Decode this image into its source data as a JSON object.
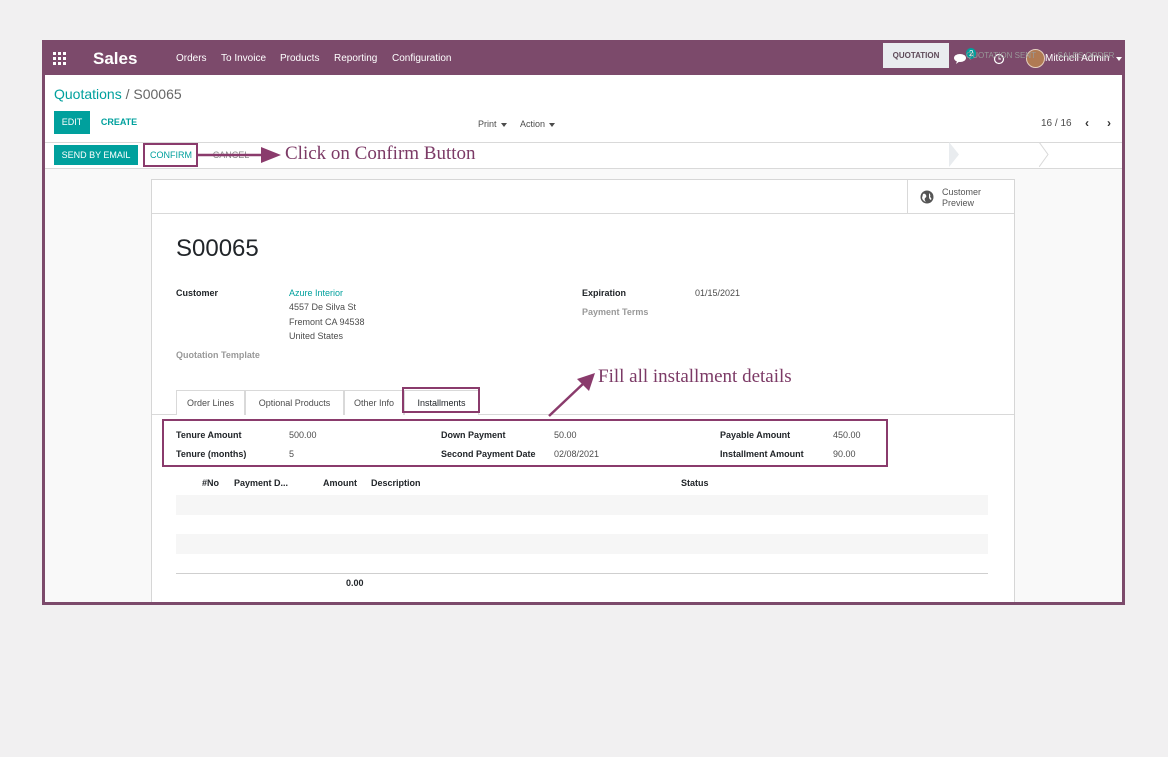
{
  "colors": {
    "brand": "#7c4a6b",
    "accent": "#00a09d",
    "annotation": "#7c3a66"
  },
  "navbar": {
    "apps_icon": "grid-icon",
    "app_name": "Sales",
    "menu": [
      "Orders",
      "To Invoice",
      "Products",
      "Reporting",
      "Configuration"
    ],
    "chat_icon": "chat-icon",
    "chat_count": "2",
    "activity_icon": "clock-icon",
    "user_name": "Mitchell Admin"
  },
  "breadcrumb": {
    "parent": "Quotations",
    "separator": " / ",
    "current": "S00065"
  },
  "controls": {
    "edit": "EDIT",
    "create": "CREATE",
    "print": "Print",
    "action": "Action",
    "pager": "16 / 16"
  },
  "statusbar": {
    "send_email": "SEND BY EMAIL",
    "confirm": "CONFIRM",
    "cancel": "CANCEL",
    "steps": [
      "QUOTATION",
      "QUOTATION SENT",
      "SALES ORDER"
    ],
    "active_step": "QUOTATION"
  },
  "annotations": {
    "confirm_note": "Click on Confirm Button",
    "installment_note": "Fill all installment details"
  },
  "sheet": {
    "preview_icon": "globe-icon",
    "preview_label": "Customer Preview",
    "name": "S00065",
    "customer_label": "Customer",
    "customer_name": "Azure Interior",
    "address": [
      "4557 De Silva St",
      "Fremont CA 94538",
      "United States"
    ],
    "quotation_template_label": "Quotation Template",
    "expiration_label": "Expiration",
    "expiration_value": "01/15/2021",
    "payment_terms_label": "Payment Terms"
  },
  "tabs": [
    "Order Lines",
    "Optional Products",
    "Other Info",
    "Installments"
  ],
  "installments": {
    "tenure_amount_label": "Tenure Amount",
    "tenure_amount": "500.00",
    "tenure_months_label": "Tenure (months)",
    "tenure_months": "5",
    "down_payment_label": "Down Payment",
    "down_payment": "50.00",
    "second_payment_date_label": "Second Payment Date",
    "second_payment_date": "02/08/2021",
    "payable_amount_label": "Payable Amount",
    "payable_amount": "450.00",
    "installment_amount_label": "Installment Amount",
    "installment_amount": "90.00"
  },
  "table": {
    "columns": [
      "#No",
      "Payment D...",
      "Amount",
      "Description",
      "Status"
    ],
    "total": "0.00"
  }
}
